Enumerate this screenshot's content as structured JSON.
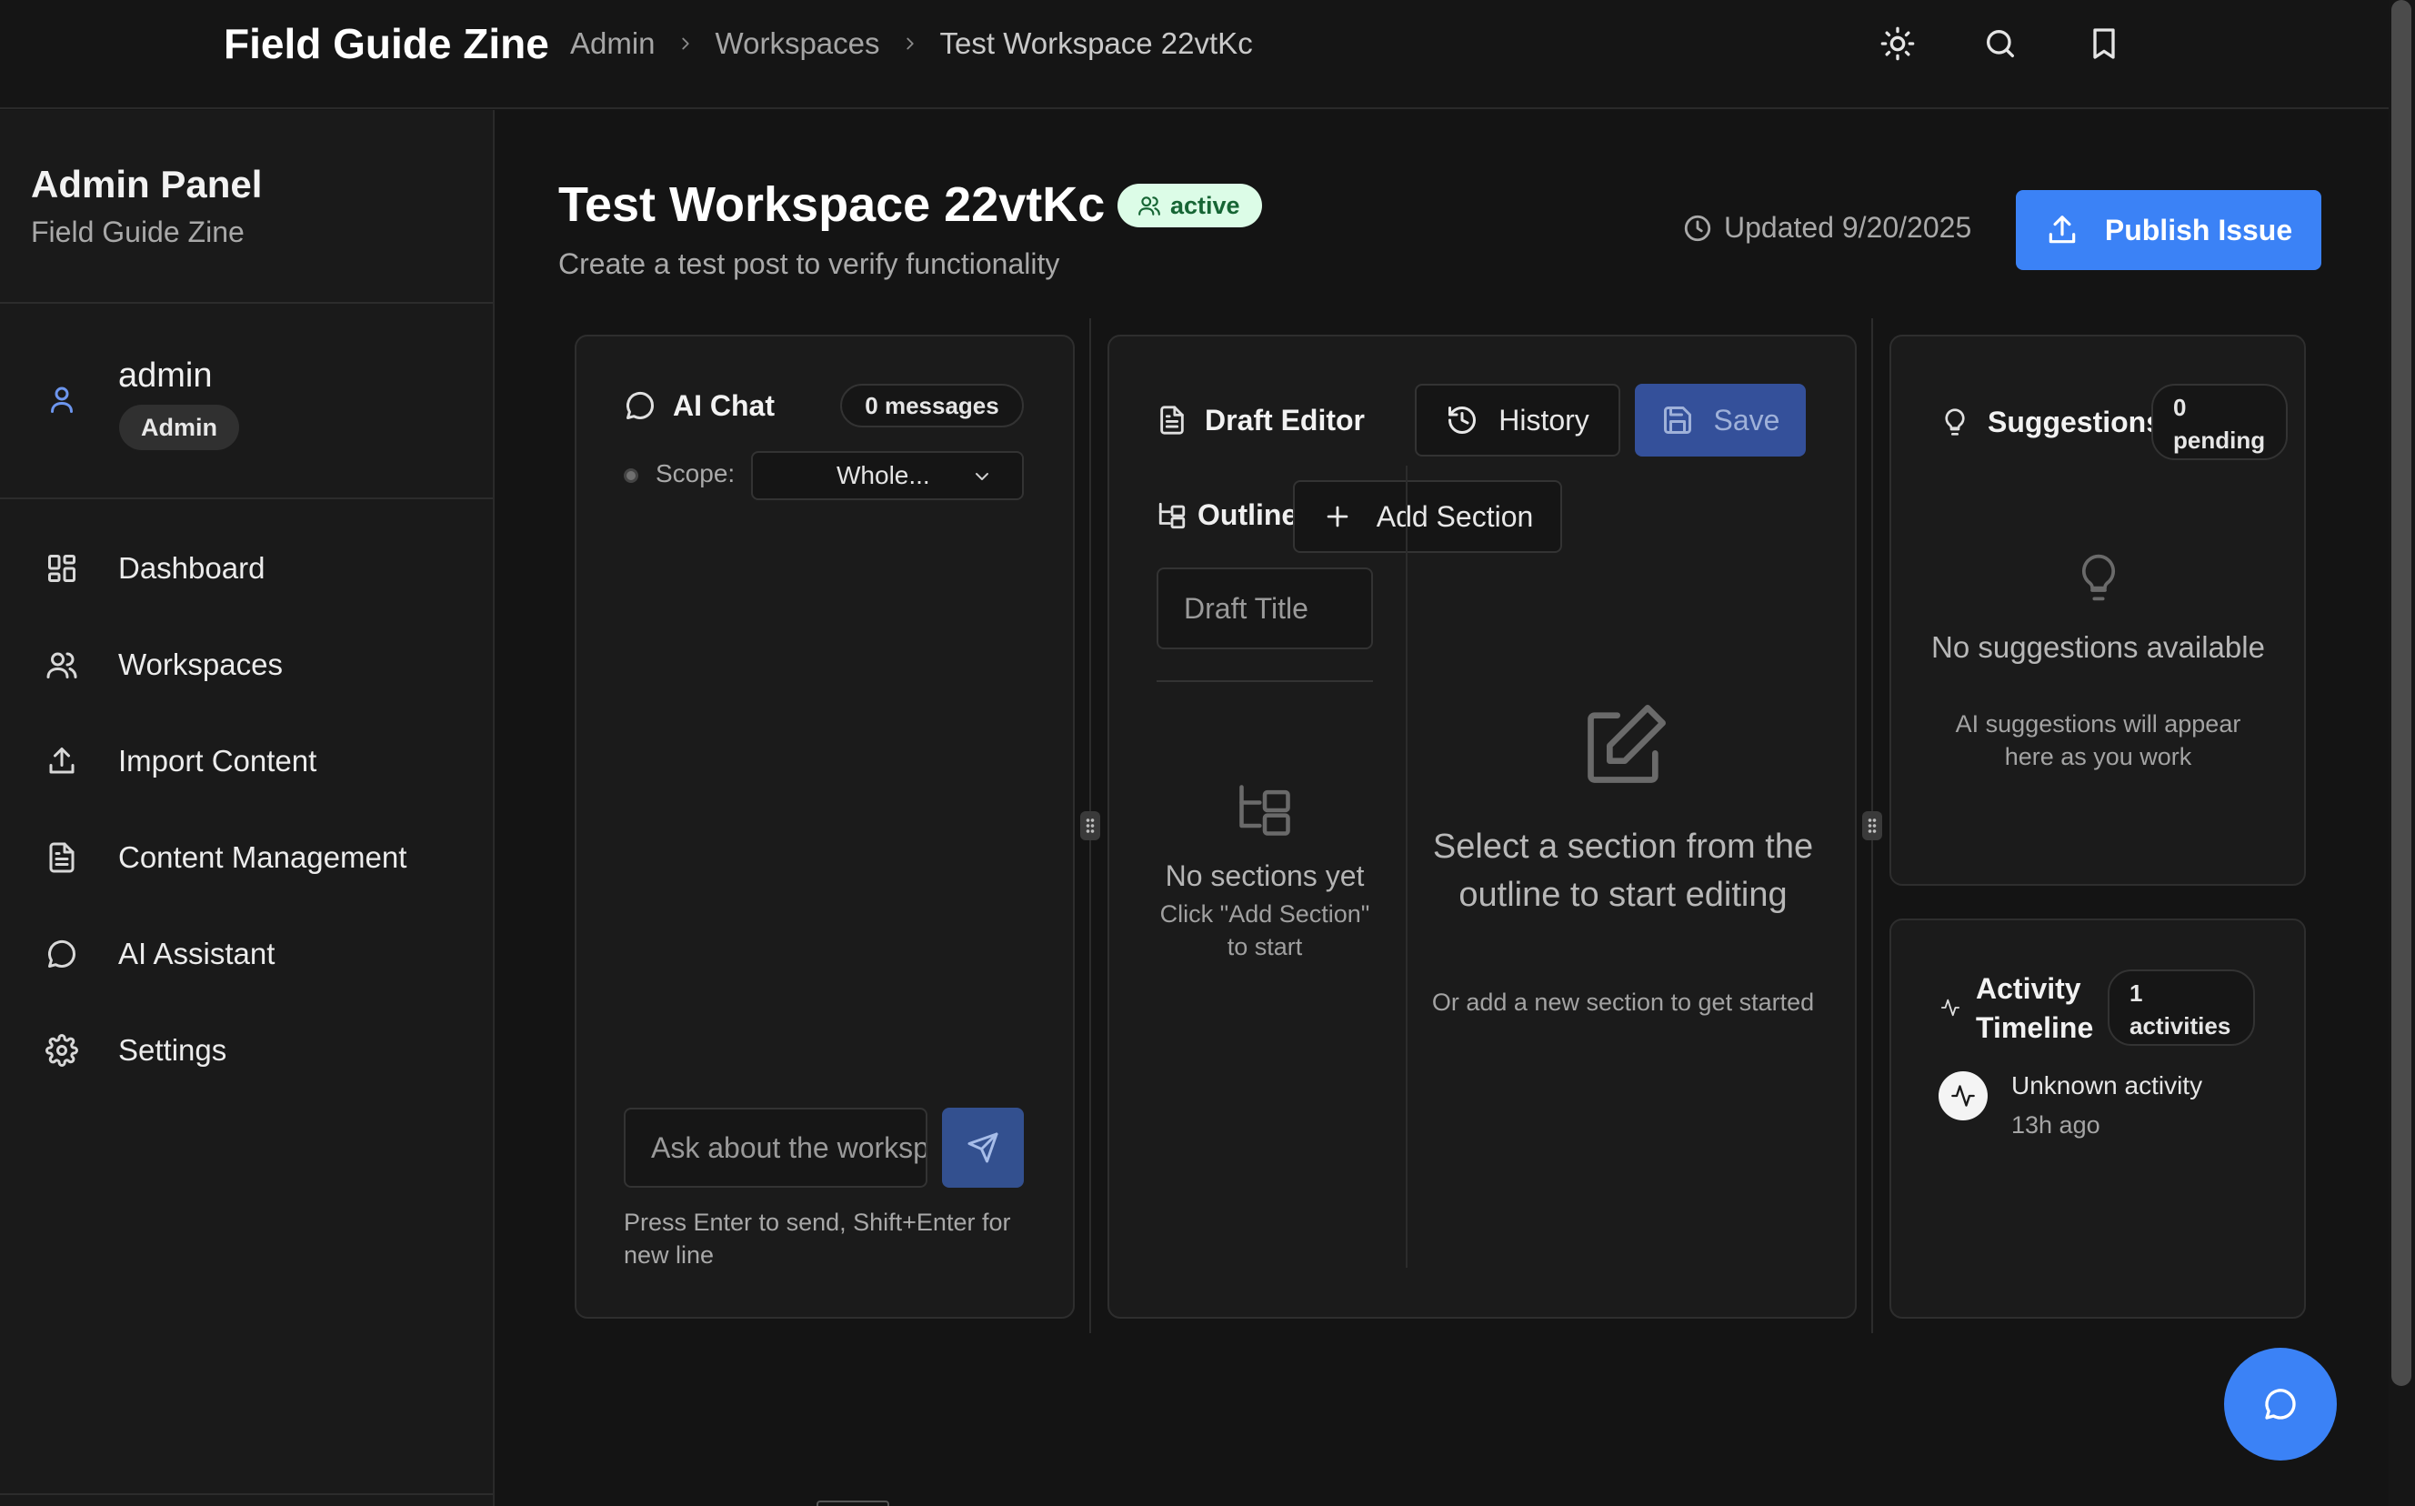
{
  "app": {
    "title": "Field Guide Zine"
  },
  "breadcrumb": [
    "Admin",
    "Workspaces",
    "Test Workspace 22vtKc"
  ],
  "topbar_icons": [
    "sun-icon",
    "search-icon",
    "bookmark-icon"
  ],
  "sidebar": {
    "title": "Admin Panel",
    "subtitle": "Field Guide Zine",
    "user": {
      "name": "admin",
      "role": "Admin"
    },
    "items": [
      {
        "label": "Dashboard",
        "icon": "dashboard-icon"
      },
      {
        "label": "Workspaces",
        "icon": "users-icon"
      },
      {
        "label": "Import Content",
        "icon": "upload-icon"
      },
      {
        "label": "Content Management",
        "icon": "file-icon"
      },
      {
        "label": "AI Assistant",
        "icon": "message-icon"
      },
      {
        "label": "Settings",
        "icon": "gear-icon"
      }
    ]
  },
  "page": {
    "title": "Test Workspace 22vtKc",
    "status": "active",
    "subtitle": "Create a test post to verify functionality",
    "updated": "Updated 9/20/2025",
    "publish_label": "Publish Issue"
  },
  "chat": {
    "title": "AI Chat",
    "count": "0 messages",
    "scope_label": "Scope:",
    "scope_value": "Whole...",
    "input_placeholder": "Ask about the workspace...",
    "hint": "Press Enter to send, Shift+Enter for new line"
  },
  "editor": {
    "title": "Draft Editor",
    "history_label": "History",
    "save_label": "Save",
    "outline_label": "Outline",
    "add_section_label": "Add Section",
    "draft_title_placeholder": "Draft Title",
    "outline_empty_title": "No sections yet",
    "outline_empty_hint": "Click \"Add Section\" to start",
    "editor_empty_title": "Select a section from the outline to start editing",
    "editor_empty_hint": "Or add a new section to get started"
  },
  "suggestions": {
    "title": "Suggestions",
    "count_num": "0",
    "count_label": "pending",
    "empty_title": "No suggestions available",
    "empty_hint": "AI suggestions will appear here as you work"
  },
  "activity": {
    "title_line1": "Activity",
    "title_line2": "Timeline",
    "count_num": "1",
    "count_label": "activities",
    "items": [
      {
        "text": "Unknown activity",
        "time": "13h ago"
      }
    ]
  },
  "colors": {
    "accent": "#3b82f6",
    "active_bg": "#dcfce7",
    "active_fg": "#166534"
  }
}
